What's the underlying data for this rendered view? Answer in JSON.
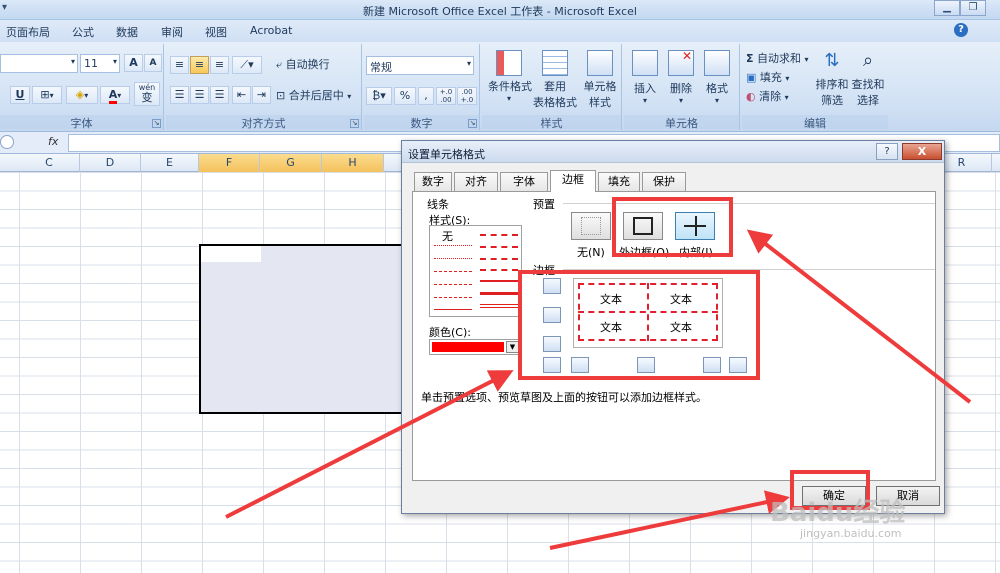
{
  "window": {
    "title": "新建 Microsoft Office Excel 工作表 - Microsoft Excel",
    "min": "▁",
    "restore": "❐"
  },
  "ribbon_tabs": [
    "页面布局",
    "公式",
    "数据",
    "审阅",
    "视图",
    "Acrobat"
  ],
  "help": "?",
  "ribbon": {
    "font": {
      "size": "11",
      "grow": "A",
      "shrink": "A",
      "underline": "U",
      "font_color_letter": "A",
      "phonetic_label": "wén",
      "phonetic_char": "变",
      "label": "字体"
    },
    "alignment": {
      "wrap_text": "自动换行",
      "merge_center": "合并后居中",
      "label": "对齐方式"
    },
    "number": {
      "format_value": "常规",
      "percent": "%",
      "comma": ",",
      "inc_decimal": "+.0 .00",
      "dec_decimal": ".00 +.0",
      "label": "数字"
    },
    "styles": {
      "conditional_line1": "条件格式",
      "table_line1": "套用",
      "table_line2": "表格格式",
      "cell_styles_line1": "单元格",
      "cell_styles_line2": "样式",
      "label": "样式"
    },
    "cells": {
      "insert": "插入",
      "delete": "删除",
      "format": "格式",
      "label": "单元格"
    },
    "editing": {
      "autosum": "自动求和",
      "fill": "填充",
      "clear": "清除",
      "sort_line1": "排序和",
      "sort_line2": "筛选",
      "find_line1": "查找和",
      "find_line2": "选择",
      "label": "编辑"
    }
  },
  "formula_bar": {
    "fx": "fx",
    "value": ""
  },
  "columns": [
    "C",
    "D",
    "E",
    "F",
    "G",
    "H",
    "R"
  ],
  "dialog": {
    "title": "设置单元格格式",
    "help": "?",
    "close": "X",
    "tabs": [
      "数字",
      "对齐",
      "字体",
      "边框",
      "填充",
      "保护"
    ],
    "active_tab": "边框",
    "line_group": "线条",
    "style_label": "样式(S):",
    "style_none": "无",
    "color_label": "颜色(C):",
    "color_value": "#ff0000",
    "presets_group": "预置",
    "preset_none": "无(N)",
    "preset_outline": "外边框(O)",
    "preset_inside": "内部(I)",
    "border_group": "边框",
    "preview_text": "文本",
    "hint": "单击预置选项、预览草图及上面的按钮可以添加边框样式。",
    "ok": "确定",
    "cancel": "取消"
  },
  "watermark": {
    "brand": "Baidu经验",
    "url": "jingyan.baidu.com"
  },
  "annotation_color": "#ee3b3b"
}
